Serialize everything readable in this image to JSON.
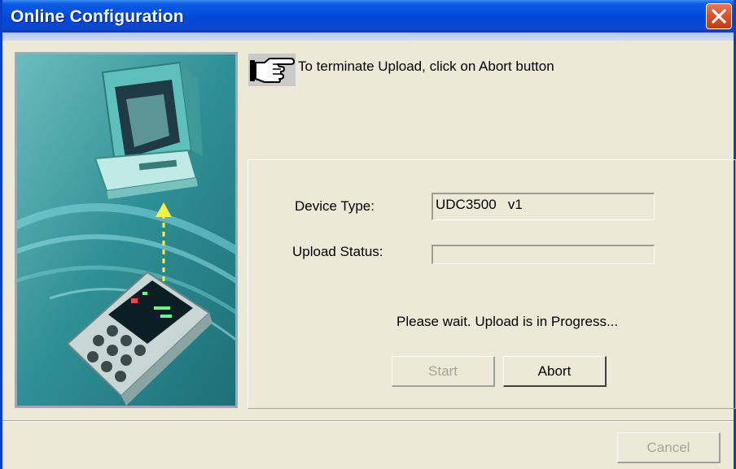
{
  "window": {
    "title": "Online Configuration",
    "close_icon": "close-icon"
  },
  "hint": {
    "icon": "pointing-hand-icon",
    "text": "To terminate Upload, click on Abort button"
  },
  "form": {
    "device_type_label": "Device Type:",
    "device_type_value": "UDC3500   v1",
    "upload_status_label": "Upload Status:",
    "upload_status_value": "",
    "status_message": "Please wait. Upload is in Progress..."
  },
  "buttons": {
    "start": "Start",
    "abort": "Abort",
    "cancel": "Cancel"
  },
  "illustration": {
    "description_icons": [
      "computer-icon",
      "controller-device-icon",
      "upload-arrow-icon"
    ]
  }
}
